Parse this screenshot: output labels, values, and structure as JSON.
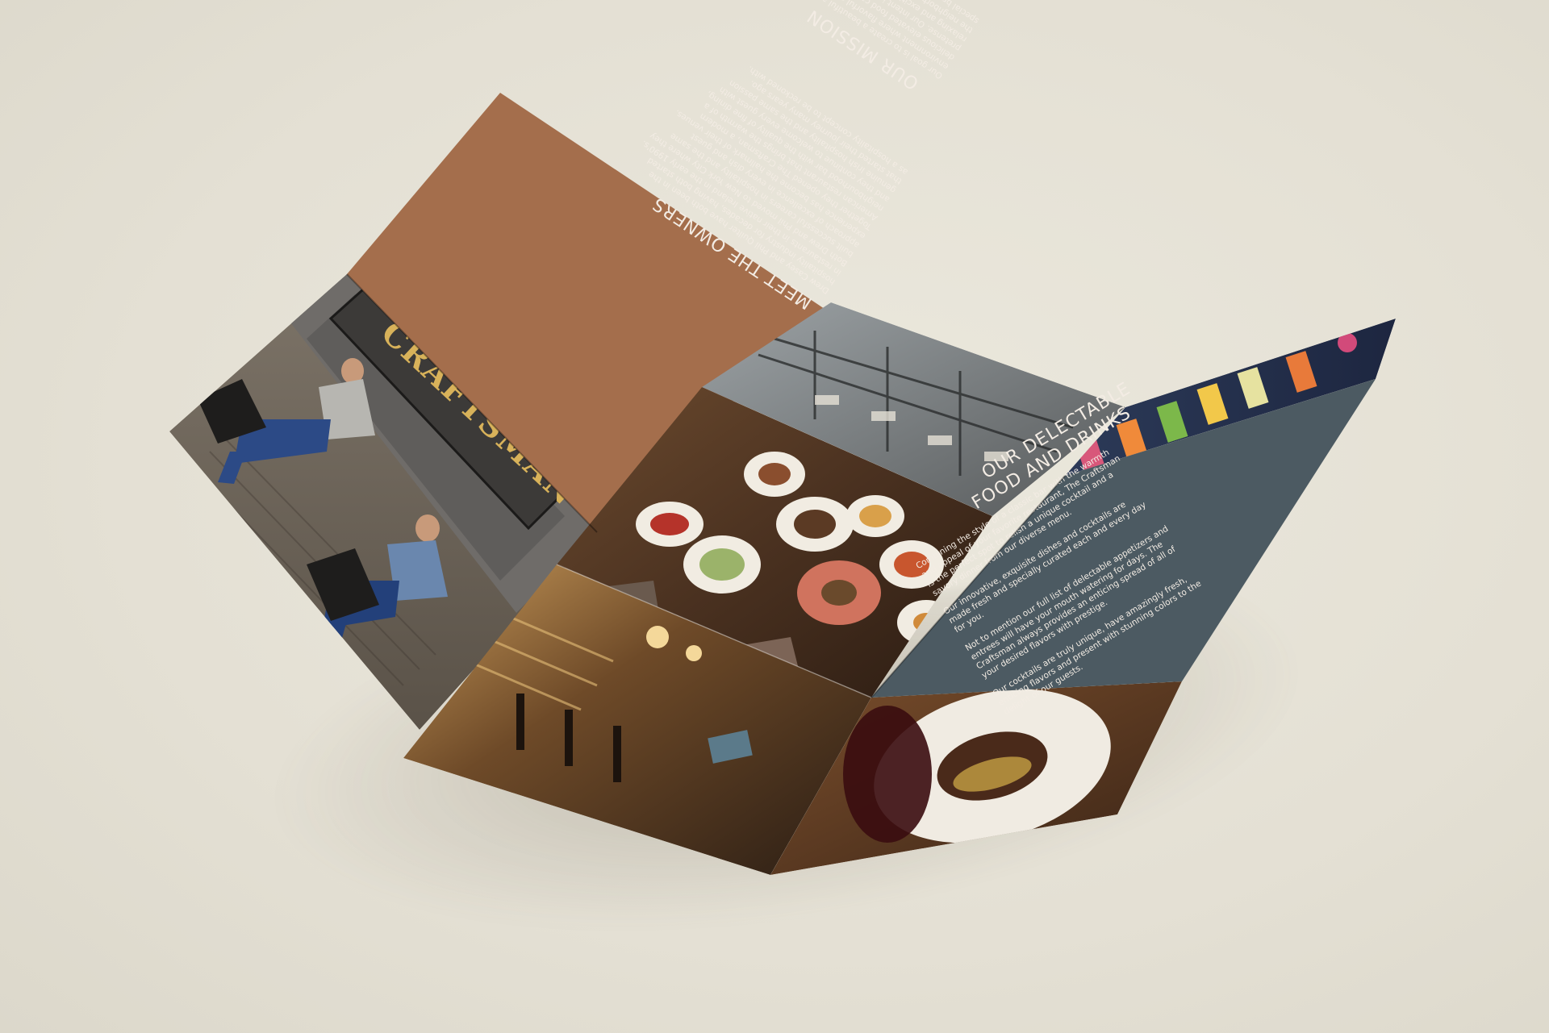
{
  "brochure": {
    "owners": {
      "heading": "MEET THE OWNERS",
      "lines": [
        "Drew Casey and Phil Quilter have both been in the",
        "hospitality industry for decades, having both started",
        "in restaurants in their native Ireland in the early 1990's.",
        "Both Drew and Phil moved to New York City where they",
        "built successful careers in hospitality and the same",
        "approach of excellence in every dish and guest",
        "experience has become the hallmark of their venues.",
        "Together they opened The Craftsman, a modern",
        "American restaurant that brings the warmth of a",
        "neighbourhood bar with the quality of fine dining,",
        "and they continue to welcome every guest with",
        "genuine Irish hospitality and the same passion",
        "that started their journey many years ago.",
        "as a hospitality concept to be reckoned with."
      ]
    },
    "mission": {
      "heading": "OUR MISSION",
      "lines": [
        "Our goal is to create a beautiful and hospitable",
        "environment where flavorful cocktails and",
        "delicious elevated food can be enjoyed without",
        "pretense. Our intent is to create spaces that are",
        "relaxing and exciting while evoking the character of",
        "the neighborhood and welcome every guest with our",
        "special brand of Craftsman hospitality."
      ]
    },
    "sign_text": "CRAFTSMAN",
    "food": {
      "heading_line1": "OUR DELECTABLE",
      "heading_line2": "FOOD AND DRINKS",
      "lines": [
        "Combining the style of a classic bar with the warmth",
        "and appeal of your favorite restaurant, The Craftsman",
        "is the perfect spot to relish a unique cocktail and a",
        "savory dinner from our diverse menu.",
        "",
        "Our innovative, exquisite dishes and cocktails are",
        "made fresh and specially curated each and every day",
        "for you.",
        "",
        "Not to mention our full list of delectable appetizers and",
        "entrees will have your mouth watering for days. The",
        "Craftsman always provides an enticing spread of all of",
        "your desired flavors with prestige.",
        "",
        "Our cocktails are truly unique, have amazingly fresh,",
        "enticing flavors and present with stunning colors to the",
        "delight of our guests."
      ]
    }
  },
  "colors": {
    "background": "#e6e2d6",
    "owners_panel": "#a46e4c",
    "food_panel": "#4c5a62",
    "sign_gold": "#d8b25a",
    "text_light": "#f3ece4"
  }
}
